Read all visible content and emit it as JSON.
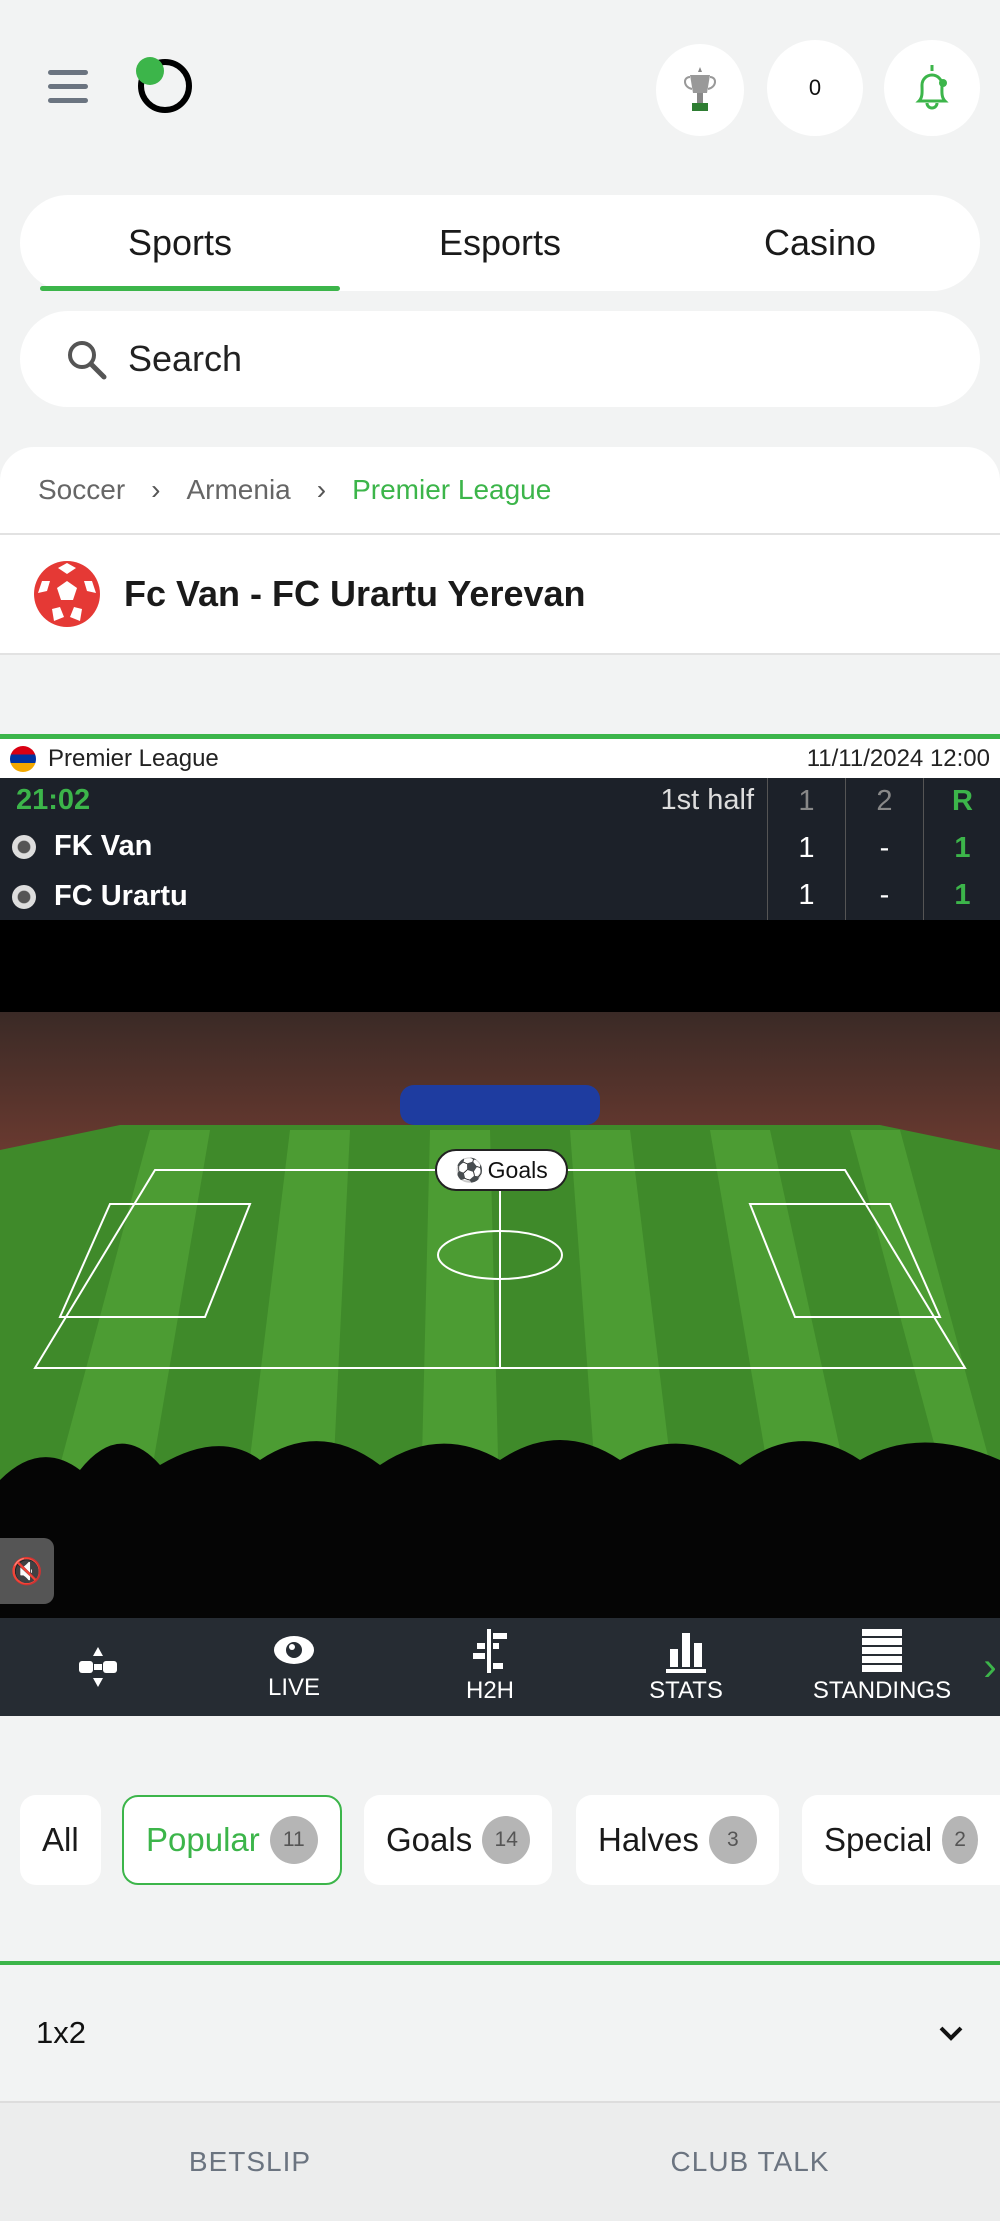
{
  "header": {
    "balance": "0",
    "icons": [
      "menu-icon",
      "logo-icon",
      "trophy-icon",
      "notification-bell-icon"
    ]
  },
  "tabs": [
    {
      "label": "Sports",
      "active": true
    },
    {
      "label": "Esports"
    },
    {
      "label": "Casino"
    }
  ],
  "search": {
    "placeholder": "Search"
  },
  "breadcrumb": [
    "Soccer",
    "Armenia",
    "Premier League"
  ],
  "match": {
    "title": "Fc Van - FC Urartu Yerevan"
  },
  "scoreboard": {
    "league": "Premier League",
    "datetime": "11/11/2024 12:00",
    "clock": "21:02",
    "period": "1st half",
    "columns": [
      "1",
      "2",
      "R"
    ],
    "teams": [
      {
        "name": "FK Van",
        "scores": [
          "1",
          "-",
          "1"
        ]
      },
      {
        "name": "FC Urartu",
        "scores": [
          "1",
          "-",
          "1"
        ]
      }
    ]
  },
  "video": {
    "event_label": "Goals"
  },
  "match_nav": [
    {
      "label": "",
      "icon": "field-icon"
    },
    {
      "label": "LIVE",
      "icon": "eye-icon"
    },
    {
      "label": "H2H",
      "icon": "h2h-icon"
    },
    {
      "label": "STATS",
      "icon": "bar-chart-icon"
    },
    {
      "label": "STANDINGS",
      "icon": "table-icon"
    }
  ],
  "filters": [
    {
      "label": "All"
    },
    {
      "label": "Popular",
      "count": "11",
      "active": true
    },
    {
      "label": "Goals",
      "count": "14"
    },
    {
      "label": "Halves",
      "count": "3"
    },
    {
      "label": "Special",
      "count": "2"
    }
  ],
  "market": {
    "title": "1x2"
  },
  "bottom": {
    "betslip": "BETSLIP",
    "club_talk": "CLUB TALK"
  },
  "colors": {
    "accent": "#3cb54a",
    "board": "#1c2129"
  }
}
